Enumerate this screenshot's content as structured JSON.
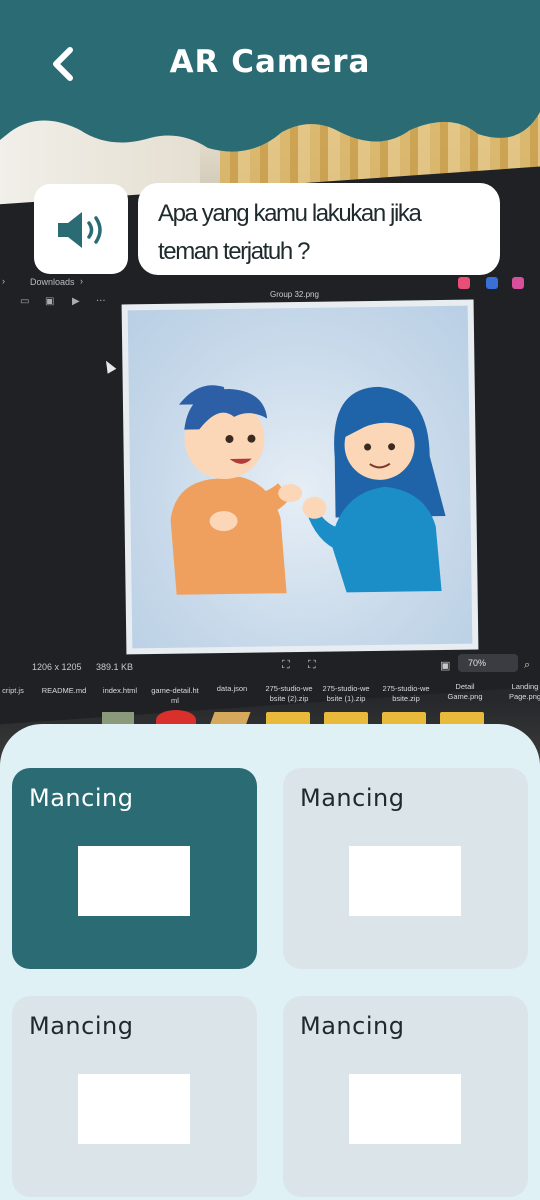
{
  "app": {
    "title": "AR Camera",
    "back_icon": "chevron-left-icon",
    "header_color": "#2b6b74"
  },
  "question": {
    "speaker_icon": "speaker-icon",
    "text": "Apa yang kamu lakukan jika teman terjatuh ?"
  },
  "options": [
    {
      "label": "Mancing",
      "selected": true
    },
    {
      "label": "Mancing",
      "selected": false
    },
    {
      "label": "Mancing",
      "selected": false
    },
    {
      "label": "Mancing",
      "selected": false
    }
  ],
  "background": {
    "breadcrumb": [
      "Downloads"
    ],
    "file_title": "Group 32.png",
    "image_dims": "1206 x 1205",
    "file_size": "389.1 KB",
    "zoom": "70%",
    "files": [
      "cript.js",
      "README.md",
      "index.html",
      "game-detail.ht ml",
      "data.json",
      "275-studio-we bsite (2).zip",
      "275-studio-we bsite (1).zip",
      "275-studio-we bsite.zip",
      "Detail Game.png",
      "Landing Page.png"
    ]
  },
  "colors": {
    "accent": "#2b6b74",
    "panel_bg": "#e0f1f5",
    "card_bg": "#dbe5e9"
  }
}
